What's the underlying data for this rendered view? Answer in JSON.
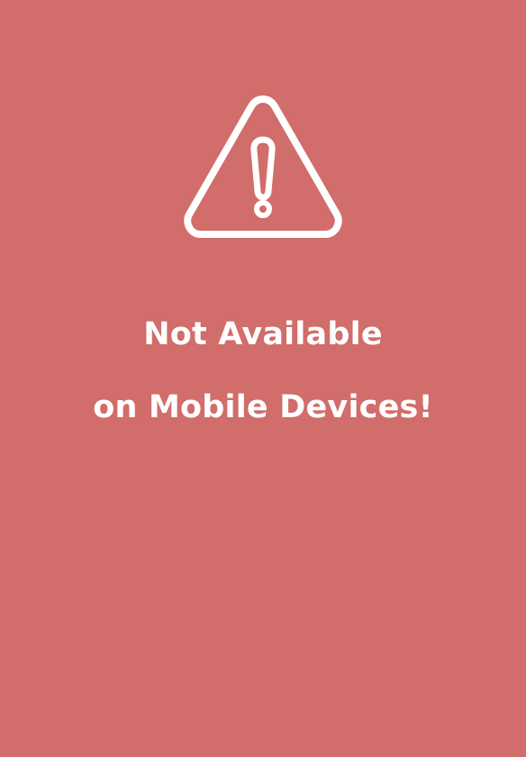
{
  "page": {
    "background_color": "#d16d6a",
    "foreground_color": "#ffffff"
  },
  "alert": {
    "icon": "warning-triangle-icon",
    "message_line_1": "Not Available",
    "message_line_2": "on Mobile Devices!"
  }
}
